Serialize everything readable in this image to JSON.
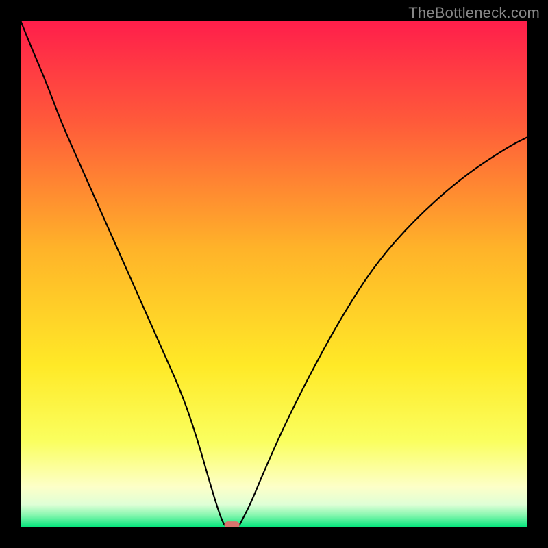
{
  "watermark": "TheBottleneck.com",
  "chart_data": {
    "type": "line",
    "title": "",
    "xlabel": "",
    "ylabel": "",
    "xlim": [
      0,
      100
    ],
    "ylim": [
      0,
      100
    ],
    "gradient_stops": [
      {
        "offset": 0.0,
        "color": "#ff1e4b"
      },
      {
        "offset": 0.2,
        "color": "#ff5a3a"
      },
      {
        "offset": 0.45,
        "color": "#ffb329"
      },
      {
        "offset": 0.68,
        "color": "#ffe927"
      },
      {
        "offset": 0.83,
        "color": "#faff5f"
      },
      {
        "offset": 0.92,
        "color": "#fdffc8"
      },
      {
        "offset": 0.955,
        "color": "#dfffd6"
      },
      {
        "offset": 0.975,
        "color": "#8af7b1"
      },
      {
        "offset": 1.0,
        "color": "#00e57a"
      }
    ],
    "series": [
      {
        "name": "left-branch",
        "x": [
          0,
          2,
          5,
          8,
          12,
          16,
          20,
          24,
          28,
          32,
          35,
          37,
          38.5,
          39.5,
          40.2
        ],
        "y": [
          100,
          95,
          88,
          80,
          71,
          62,
          53,
          44,
          35,
          26,
          17,
          10,
          5,
          2,
          0.5
        ]
      },
      {
        "name": "right-branch",
        "x": [
          43.2,
          44,
          45.5,
          48,
          52,
          57,
          63,
          70,
          78,
          87,
          96,
          100
        ],
        "y": [
          0.5,
          2,
          5,
          11,
          20,
          30,
          41,
          52,
          61,
          69,
          75,
          77
        ]
      }
    ],
    "marker": {
      "name": "bottleneck-marker",
      "x_center": 41.7,
      "x_halfwidth": 1.5,
      "y": 0.5,
      "height": 1.4,
      "color": "#d9736e"
    }
  }
}
